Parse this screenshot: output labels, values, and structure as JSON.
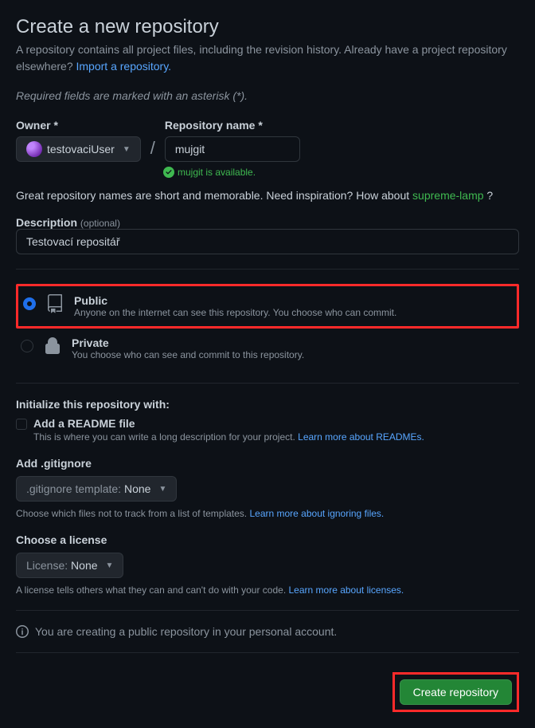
{
  "header": {
    "title": "Create a new repository",
    "subtitle_a": "A repository contains all project files, including the revision history. Already have a project repository elsewhere? ",
    "import_link": "Import a repository."
  },
  "required_note": "Required fields are marked with an asterisk (*).",
  "owner": {
    "label": "Owner *",
    "value": "testovaciUser"
  },
  "repo": {
    "label": "Repository name *",
    "value": "mujgit",
    "available_text": "mujgit is available."
  },
  "inspiration": {
    "text_a": "Great repository names are short and memorable. Need inspiration? How about ",
    "suggestion": "supreme-lamp",
    "text_b": " ?"
  },
  "description": {
    "label": "Description",
    "optional": "(optional)",
    "value": "Testovací repositář"
  },
  "visibility": {
    "public": {
      "title": "Public",
      "desc": "Anyone on the internet can see this repository. You choose who can commit."
    },
    "private": {
      "title": "Private",
      "desc": "You choose who can see and commit to this repository."
    }
  },
  "initialize": {
    "heading": "Initialize this repository with:",
    "readme_label": "Add a README file",
    "readme_desc_a": "This is where you can write a long description for your project. ",
    "readme_link": "Learn more about READMEs."
  },
  "gitignore": {
    "heading": "Add .gitignore",
    "button_prefix": ".gitignore template:",
    "button_value": " None",
    "help_a": "Choose which files not to track from a list of templates. ",
    "help_link": "Learn more about ignoring files."
  },
  "license": {
    "heading": "Choose a license",
    "button_prefix": "License:",
    "button_value": " None",
    "help_a": "A license tells others what they can and can't do with your code. ",
    "help_link": "Learn more about licenses."
  },
  "info_text": "You are creating a public repository in your personal account.",
  "submit_label": "Create repository"
}
